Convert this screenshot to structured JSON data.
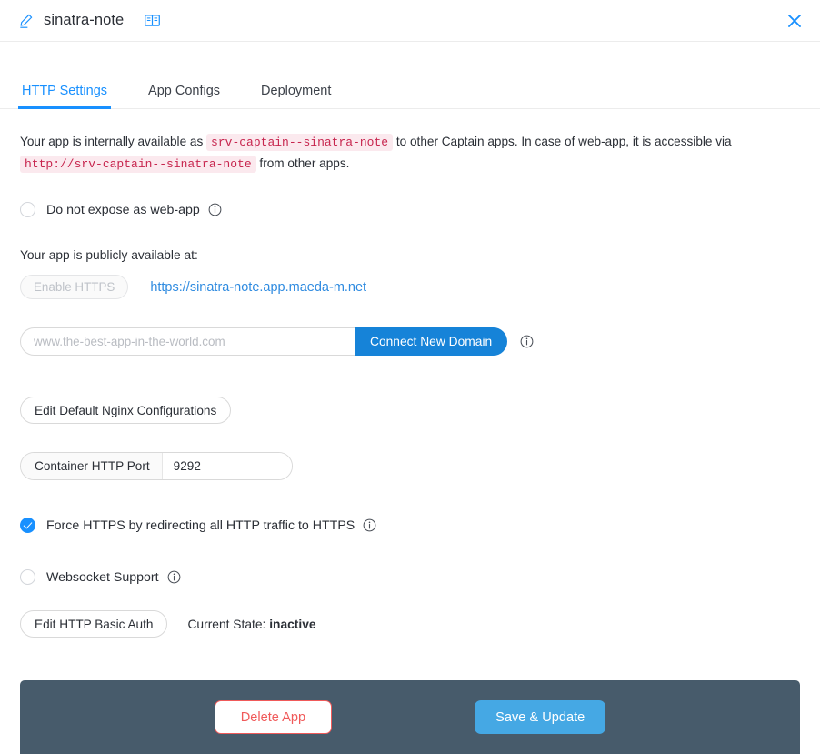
{
  "header": {
    "app_name": "sinatra-note",
    "edit_icon": "pencil-edit-icon",
    "docs_icon": "open-book-icon",
    "close_icon": "close-x-icon",
    "accent_color": "#1890ff"
  },
  "tabs": [
    {
      "label": "HTTP Settings",
      "active": true
    },
    {
      "label": "App Configs",
      "active": false
    },
    {
      "label": "Deployment",
      "active": false
    }
  ],
  "description": {
    "part1": "Your app is internally available as ",
    "code1": "srv-captain--sinatra-note",
    "part2": " to other Captain apps. In case of web-app, it is accessible via ",
    "code2": "http://srv-captain--sinatra-note",
    "part3": " from other apps."
  },
  "expose": {
    "label": "Do not expose as web-app",
    "checked": false,
    "info_icon": "info-circle-icon"
  },
  "public": {
    "heading": "Your app is publicly available at:",
    "enable_https_label": "Enable HTTPS",
    "enable_https_disabled": true,
    "url": "https://sinatra-note.app.maeda-m.net"
  },
  "domain": {
    "placeholder": "www.the-best-app-in-the-world.com",
    "value": "",
    "connect_label": "Connect New Domain",
    "info_icon": "info-circle-icon",
    "button_color": "#1683d8"
  },
  "nginx": {
    "edit_label": "Edit Default Nginx Configurations"
  },
  "port": {
    "addon_label": "Container HTTP Port",
    "value": "9292"
  },
  "force_https": {
    "label": "Force HTTPS by redirecting all HTTP traffic to HTTPS",
    "checked": true,
    "info_icon": "info-circle-icon"
  },
  "websocket": {
    "label": "Websocket Support",
    "checked": false,
    "info_icon": "info-circle-icon"
  },
  "basic_auth": {
    "edit_label": "Edit HTTP Basic Auth",
    "state_prefix": "Current State: ",
    "state_value": "inactive"
  },
  "footer": {
    "delete_label": "Delete App",
    "save_label": "Save & Update",
    "bar_color": "#475b6b",
    "delete_color": "#f05a5a",
    "save_color": "#45a8e4"
  }
}
